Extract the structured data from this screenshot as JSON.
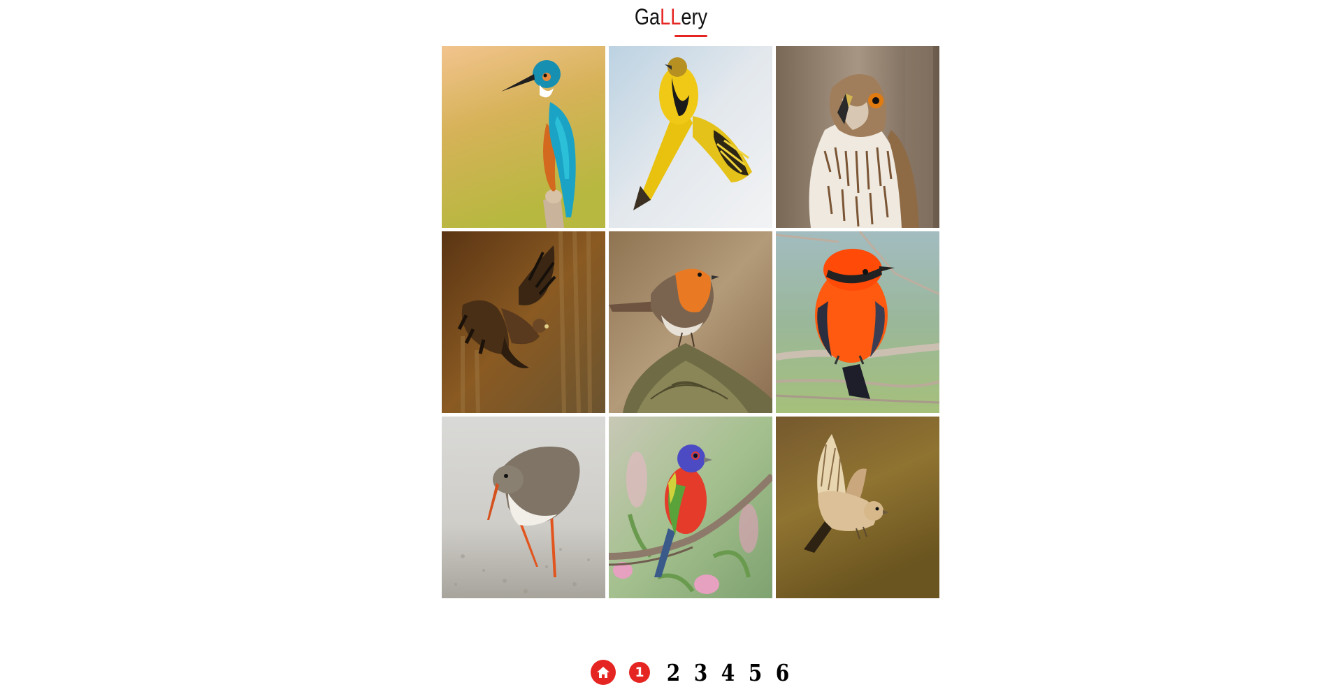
{
  "header": {
    "title_pre": "Ga",
    "title_accent": "LL",
    "title_post": "ery",
    "accent_color": "#e52521"
  },
  "gallery": {
    "items": [
      {
        "subject": "kingfisher"
      },
      {
        "subject": "yellow bird in flight"
      },
      {
        "subject": "hawk portrait"
      },
      {
        "subject": "brown bird of prey in flight"
      },
      {
        "subject": "robin on post"
      },
      {
        "subject": "red flycatcher on branch"
      },
      {
        "subject": "redshank wading"
      },
      {
        "subject": "painted bunting on branch"
      },
      {
        "subject": "small bird in flight"
      }
    ]
  },
  "pagination": {
    "home_icon": "home-icon",
    "current": "1",
    "pages": [
      "2",
      "3",
      "4",
      "5",
      "6"
    ]
  }
}
